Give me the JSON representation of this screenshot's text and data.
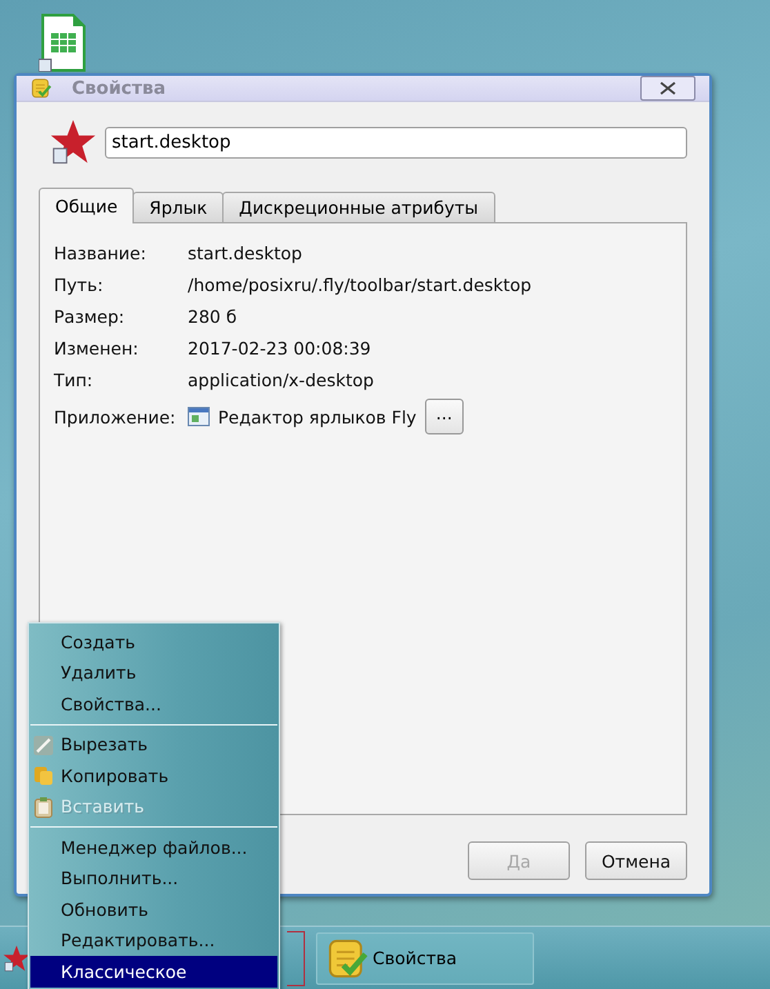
{
  "window": {
    "title": "Свойства"
  },
  "name_field": {
    "value": "start.desktop"
  },
  "tabs": [
    {
      "label": "Общие",
      "selected": true
    },
    {
      "label": "Ярлык",
      "selected": false
    },
    {
      "label": "Дискреционные атрибуты",
      "selected": false
    }
  ],
  "properties": [
    {
      "label": "Название:",
      "value": "start.desktop"
    },
    {
      "label": "Путь:",
      "value": "/home/posixru/.fly/toolbar/start.desktop"
    },
    {
      "label": "Размер:",
      "value": "280 б"
    },
    {
      "label": "Изменен:",
      "value": "2017-02-23 00:08:39"
    },
    {
      "label": "Тип:",
      "value": "application/x-desktop"
    }
  ],
  "application": {
    "label": "Приложение:",
    "value": "Редактор ярлыков Fly",
    "button": "..."
  },
  "buttons": [
    {
      "label": "Да",
      "disabled": true
    },
    {
      "label": "Отмена",
      "disabled": false
    }
  ],
  "context_menu": [
    {
      "kind": "item",
      "label": "Создать",
      "disabled": false,
      "selected": false
    },
    {
      "kind": "item",
      "label": "Удалить",
      "disabled": false,
      "selected": false
    },
    {
      "kind": "item",
      "label": "Свойства...",
      "disabled": false,
      "selected": false
    },
    {
      "kind": "separator"
    },
    {
      "kind": "cut",
      "label": "Вырезать",
      "disabled": false,
      "selected": false
    },
    {
      "kind": "copy",
      "label": "Копировать",
      "disabled": false,
      "selected": false
    },
    {
      "kind": "paste",
      "label": "Вставить",
      "disabled": true,
      "selected": false
    },
    {
      "kind": "separator"
    },
    {
      "kind": "item",
      "label": "Менеджер файлов...",
      "disabled": false,
      "selected": false
    },
    {
      "kind": "item",
      "label": "Выполнить...",
      "disabled": false,
      "selected": false
    },
    {
      "kind": "item",
      "label": "Обновить",
      "disabled": false,
      "selected": false
    },
    {
      "kind": "item",
      "label": "Редактировать...",
      "disabled": false,
      "selected": false
    },
    {
      "kind": "item",
      "label": "Классическое",
      "disabled": false,
      "selected": true
    }
  ],
  "taskbar": {
    "tasks": [
      {
        "label": "Свойства"
      }
    ]
  }
}
